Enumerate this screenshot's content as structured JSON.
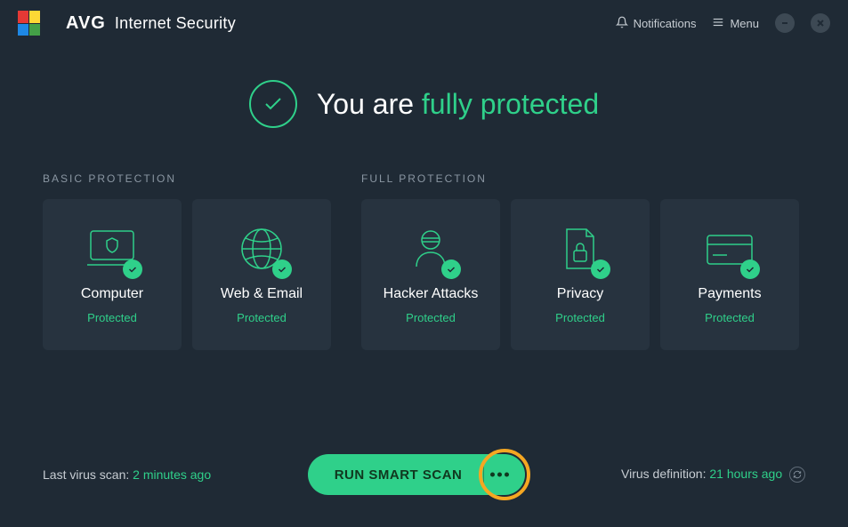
{
  "header": {
    "brand": "AVG",
    "title": "Internet Security",
    "notifications_label": "Notifications",
    "menu_label": "Menu"
  },
  "status": {
    "prefix": "You are ",
    "highlight": "fully protected"
  },
  "sections": {
    "basic": {
      "label": "BASIC PROTECTION",
      "cards": [
        {
          "title": "Computer",
          "status": "Protected"
        },
        {
          "title": "Web & Email",
          "status": "Protected"
        }
      ]
    },
    "full": {
      "label": "FULL PROTECTION",
      "cards": [
        {
          "title": "Hacker Attacks",
          "status": "Protected"
        },
        {
          "title": "Privacy",
          "status": "Protected"
        },
        {
          "title": "Payments",
          "status": "Protected"
        }
      ]
    }
  },
  "footer": {
    "last_scan_label": "Last virus scan: ",
    "last_scan_time": "2 minutes ago",
    "scan_button": "RUN SMART SCAN",
    "virus_def_label": "Virus definition: ",
    "virus_def_time": "21 hours ago"
  },
  "colors": {
    "accent": "#2fd08a",
    "background": "#1f2a35",
    "card": "#27333f",
    "highlight_ring": "#f5a722"
  }
}
